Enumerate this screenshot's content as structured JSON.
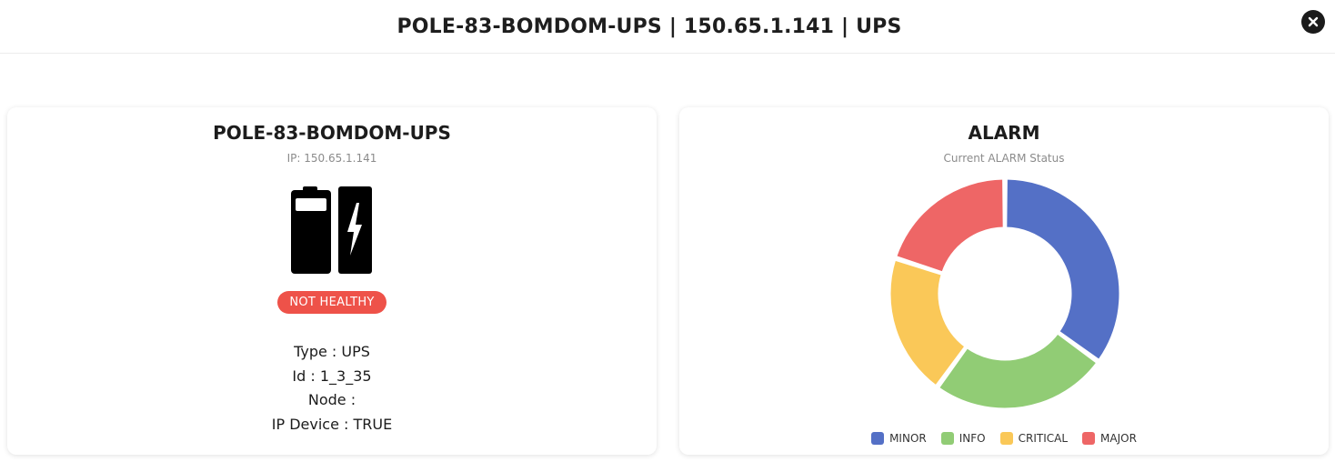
{
  "modal": {
    "title": "POLE-83-BOMDOM-UPS | 150.65.1.141 | UPS",
    "close_icon": "close-icon"
  },
  "device": {
    "name": "POLE-83-BOMDOM-UPS",
    "ip_label": "IP: 150.65.1.141",
    "icon": "ups-battery-icon",
    "status": "NOT HEALTHY",
    "status_color": "#ee5249",
    "info": [
      {
        "text": "Type : UPS"
      },
      {
        "text": "Id : 1_3_35"
      },
      {
        "text": "Node :"
      },
      {
        "text": "IP Device : TRUE"
      }
    ]
  },
  "chart_data": {
    "type": "pie",
    "title": "ALARM",
    "subtitle": "Current ALARM Status",
    "categories": [
      "MINOR",
      "INFO",
      "CRITICAL",
      "MAJOR"
    ],
    "values": [
      35,
      25,
      20,
      20
    ],
    "colors": [
      "#5470c6",
      "#91cc75",
      "#fac858",
      "#ee6666"
    ],
    "legend_position": "bottom",
    "donut": true
  }
}
